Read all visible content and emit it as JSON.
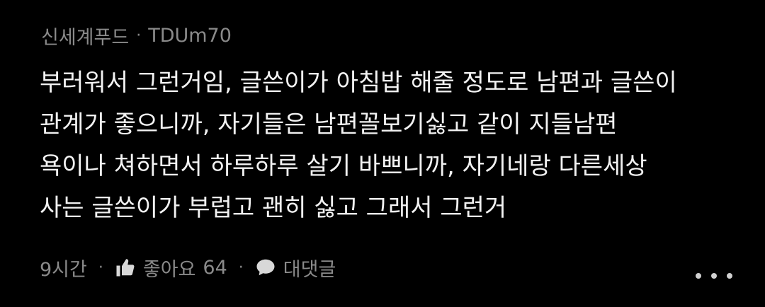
{
  "comment": {
    "author_source": "신세계푸드",
    "separator": "·",
    "author_id": "TDUm70",
    "text": "부러워서 그런거임, 글쓴이가 아침밥 해줄 정도로 남편과 글쓴이\n관계가 좋으니까, 자기들은 남편꼴보기싫고 같이 지들남편\n욕이나 쳐하면서 하루하루 살기 바쁘니까, 자기네랑 다른세상\n사는 글쓴이가  부럽고 괜히 싫고 그래서 그런거",
    "time": "9시간",
    "like_label": "좋아요",
    "like_count": "64",
    "reply_label": "대댓글"
  },
  "icons": {
    "like": "thumbs-up-icon",
    "reply": "speech-bubble-icon",
    "more": "more-dots-icon"
  },
  "colors": {
    "background": "#000000",
    "text": "#f2f2f2",
    "meta": "#8a8a8a"
  }
}
